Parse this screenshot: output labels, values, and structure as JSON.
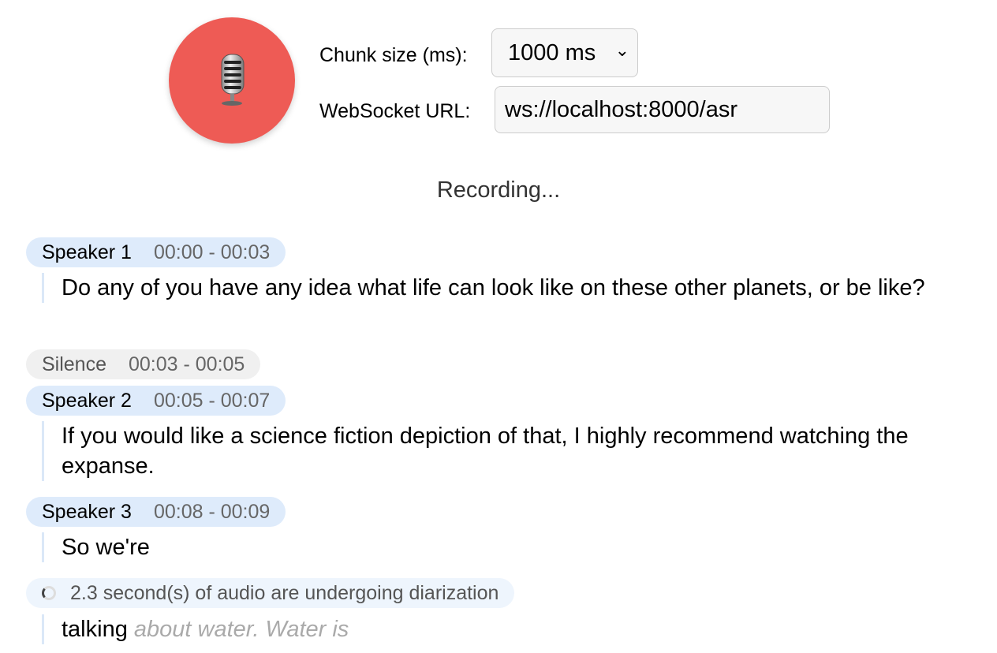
{
  "controls": {
    "record_button_icon": "studio-microphone-icon",
    "record_button_color": "#ee5b55",
    "chunk_size_label": "Chunk size (ms):",
    "chunk_size_value": "1000 ms",
    "websocket_label": "WebSocket URL:",
    "websocket_value": "ws://localhost:8000/asr"
  },
  "status": "Recording...",
  "transcript": [
    {
      "speaker": "Speaker 1",
      "time": "00:00 - 00:03",
      "text": "Do any of you have any idea what life can look like on these other planets, or be like?"
    },
    {
      "speaker": "Silence",
      "time": "00:03 - 00:05"
    },
    {
      "speaker": "Speaker 2",
      "time": "00:05 - 00:07",
      "text": "If you would like a science fiction depiction of that, I highly recommend watching the expanse."
    },
    {
      "speaker": "Speaker 3",
      "time": "00:08 - 00:09",
      "text": "So we're"
    }
  ],
  "diarization": {
    "message": "2.3 second(s) of audio are undergoing diarization",
    "text": "talking",
    "buffer": "about water. Water is"
  }
}
